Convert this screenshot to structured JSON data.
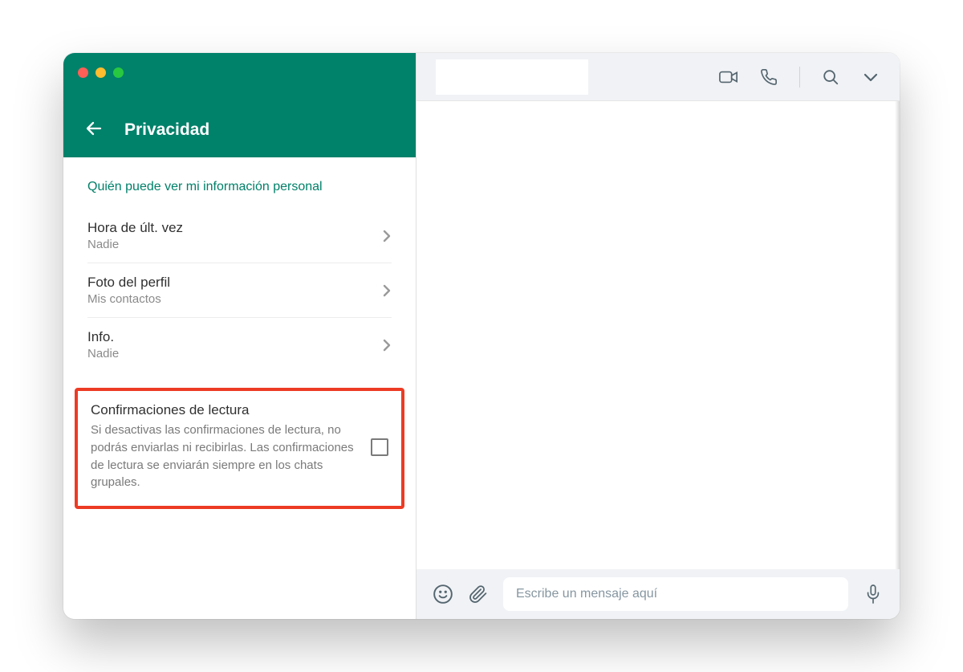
{
  "header": {
    "title": "Privacidad"
  },
  "section_heading": "Quién puede ver mi información personal",
  "items": [
    {
      "label": "Hora de últ. vez",
      "value": "Nadie"
    },
    {
      "label": "Foto del perfil",
      "value": "Mis contactos"
    },
    {
      "label": "Info.",
      "value": "Nadie"
    }
  ],
  "read_receipts": {
    "title": "Confirmaciones de lectura",
    "description": "Si desactivas las confirmaciones de lectura, no podrás enviarlas ni recibirlas. Las confirmaciones de lectura se enviarán siempre en los chats grupales.",
    "checked": false
  },
  "composer": {
    "placeholder": "Escribe un mensaje aquí"
  }
}
